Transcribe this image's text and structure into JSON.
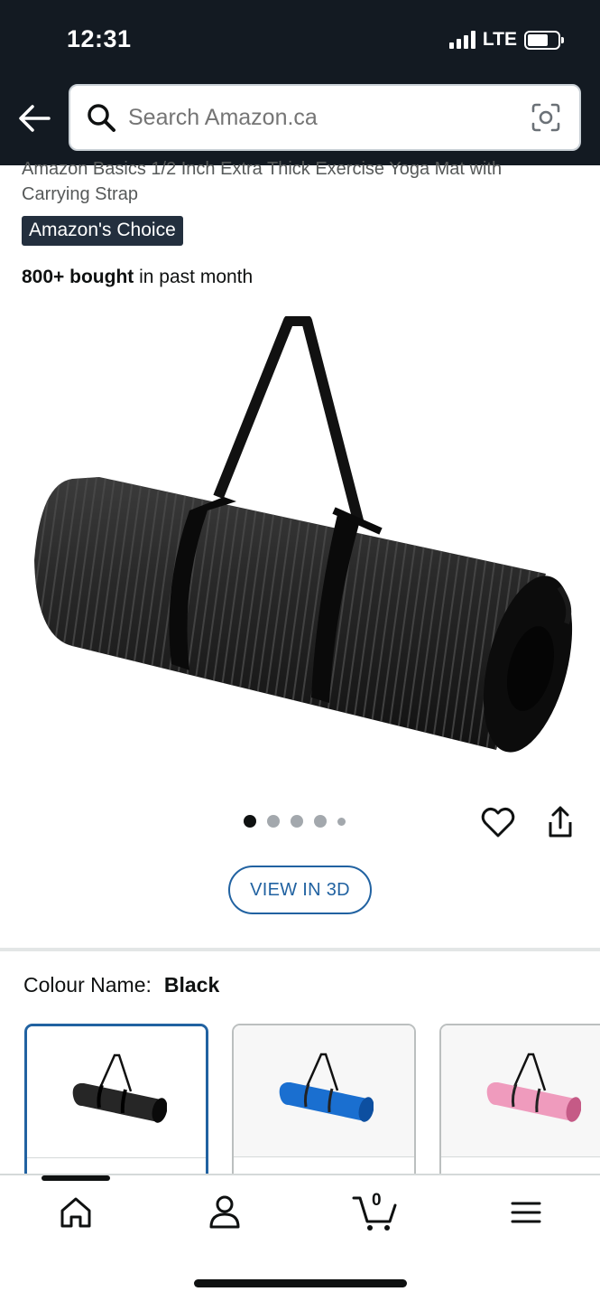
{
  "status_bar": {
    "time": "12:31",
    "network": "LTE"
  },
  "search": {
    "placeholder": "Search Amazon.ca"
  },
  "product": {
    "title_line1": "Amazon Basics 1/2 Inch Extra Thick Exercise Yoga Mat with",
    "title_line2": "Carrying Strap",
    "badge": "Amazon's Choice",
    "bought_count": "800+ bought",
    "bought_suffix": " in past month"
  },
  "gallery": {
    "image_count": 5,
    "active_index": 0
  },
  "view3d_label": "VIEW IN 3D",
  "colour": {
    "label": "Colour Name:",
    "selected": "Black",
    "options": [
      {
        "name": "Black",
        "color": "#1c1c1c"
      },
      {
        "name": "Blue",
        "color": "#1a6fd0"
      },
      {
        "name": "Pink",
        "color": "#ef9bbd"
      }
    ]
  },
  "bottom_nav": {
    "items": [
      "home-icon",
      "account-icon",
      "cart-icon",
      "menu-icon"
    ],
    "cart_count": "0"
  },
  "colors": {
    "header_bg": "#131a22",
    "link_blue": "#2162a1",
    "badge_bg": "#232f3e"
  }
}
